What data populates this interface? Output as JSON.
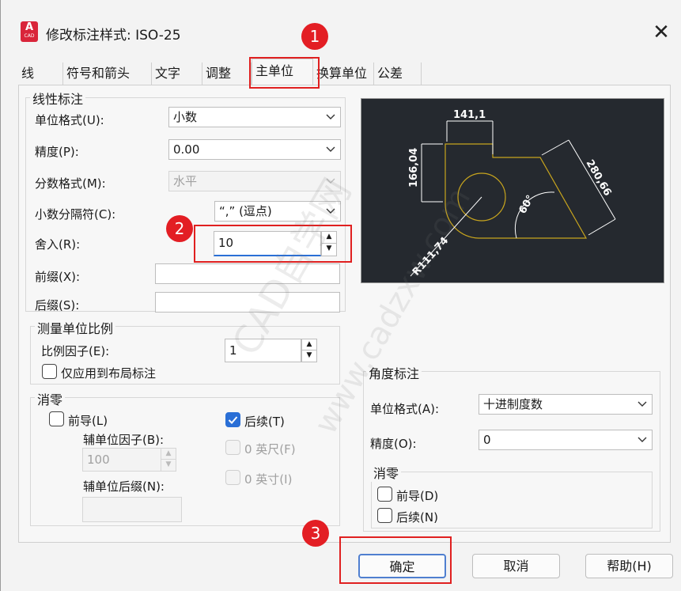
{
  "window": {
    "title": "修改标注样式: ISO-25",
    "app_icon_letter": "A",
    "app_icon_sub": "CAD"
  },
  "tabs": [
    {
      "label": "线"
    },
    {
      "label": "符号和箭头"
    },
    {
      "label": "文字"
    },
    {
      "label": "调整"
    },
    {
      "label": "主单位"
    },
    {
      "label": "换算单位"
    },
    {
      "label": "公差"
    }
  ],
  "active_tab": "主单位",
  "linear": {
    "title": "线性标注",
    "unit_format_label": "单位格式(U):",
    "unit_format_value": "小数",
    "precision_label": "精度(P):",
    "precision_value": "0.00",
    "fraction_label": "分数格式(M):",
    "fraction_value": "水平",
    "decimal_sep_label": "小数分隔符(C):",
    "decimal_sep_value": "“,” (逗点)",
    "round_label": "舍入(R):",
    "round_value": "10",
    "prefix_label": "前缀(X):",
    "prefix_value": "",
    "suffix_label": "后缀(S):",
    "suffix_value": ""
  },
  "scale": {
    "title": "测量单位比例",
    "factor_label": "比例因子(E):",
    "factor_value": "1",
    "layout_only_label": "仅应用到布局标注",
    "layout_only_checked": false
  },
  "zero_suppress": {
    "title": "消零",
    "leading_label": "前导(L)",
    "leading_checked": false,
    "trailing_label": "后续(T)",
    "trailing_checked": true,
    "sub_factor_label": "辅单位因子(B):",
    "sub_factor_value": "100",
    "sub_suffix_label": "辅单位后缀(N):",
    "feet_label": "0 英尺(F)",
    "inches_label": "0 英寸(I)"
  },
  "angular": {
    "title": "角度标注",
    "unit_format_label": "单位格式(A):",
    "unit_format_value": "十进制度数",
    "precision_label": "精度(O):",
    "precision_value": "0",
    "zero_title": "消零",
    "leading_label": "前导(D)",
    "trailing_label": "后续(N)"
  },
  "preview": {
    "dim_top": "141,1",
    "dim_left": "166,04",
    "dim_right": "280,66",
    "dim_angle": "60°",
    "dim_radius": "R111,74"
  },
  "buttons": {
    "ok": "确定",
    "cancel": "取消",
    "help": "帮助(H)"
  },
  "annotations": {
    "badge1": "1",
    "badge2": "2",
    "badge3": "3"
  },
  "watermark": {
    "text": "CAD自学网",
    "url": "www.cadzxw.com"
  },
  "colors": {
    "accent": "#2a6fd6",
    "highlight": "#e02020",
    "preview_bg": "#25292f",
    "preview_line": "#c8a51e"
  }
}
